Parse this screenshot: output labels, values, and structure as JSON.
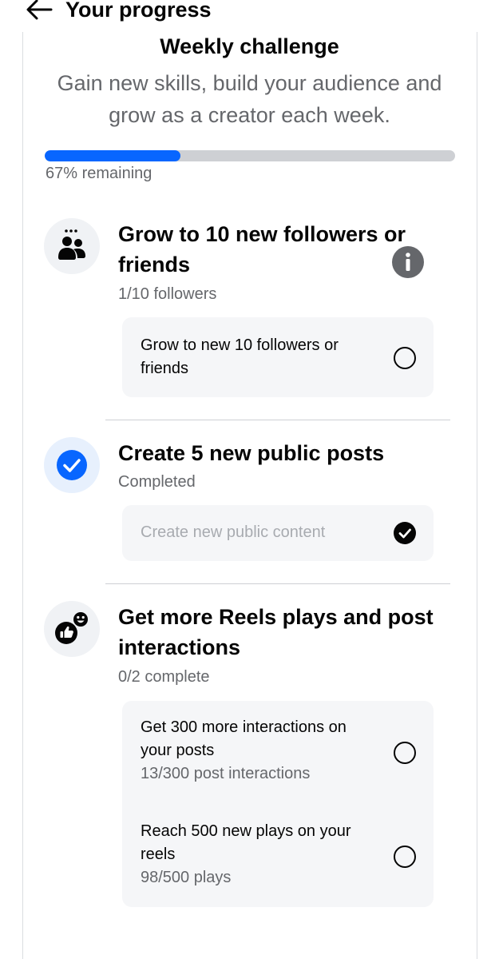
{
  "header": {
    "title": "Your progress"
  },
  "challenge": {
    "title": "Weekly challenge",
    "subtitle": "Gain new skills, build your audience and grow as a creator each week.",
    "progress_fraction": 0.33,
    "progress_text": "67% remaining"
  },
  "sections": [
    {
      "title": "Grow to 10 new followers or friends",
      "meta": "1/10 followers",
      "icon": "people-icon",
      "tasks": [
        {
          "label": "Grow to new 10 followers or friends",
          "done": false
        }
      ]
    },
    {
      "title": "Create 5 new public posts",
      "meta": "Completed",
      "icon": "checkmark-icon",
      "tasks": [
        {
          "label": "Create new public content",
          "done": true
        }
      ]
    },
    {
      "title": "Get more Reels plays and post interactions",
      "meta": "0/2 complete",
      "icon": "thumbs-up-reaction-icon",
      "tasks": [
        {
          "label": "Get 300 more interactions on your posts",
          "meta": "13/300 post interactions",
          "done": false
        },
        {
          "label": "Reach 500 new plays on your reels",
          "meta": "98/500 plays",
          "done": false
        }
      ]
    }
  ],
  "colors": {
    "accent": "#0866ff",
    "track": "#ced0d4",
    "secondary_text": "#65676b",
    "task_background": "#f5f6f8"
  }
}
